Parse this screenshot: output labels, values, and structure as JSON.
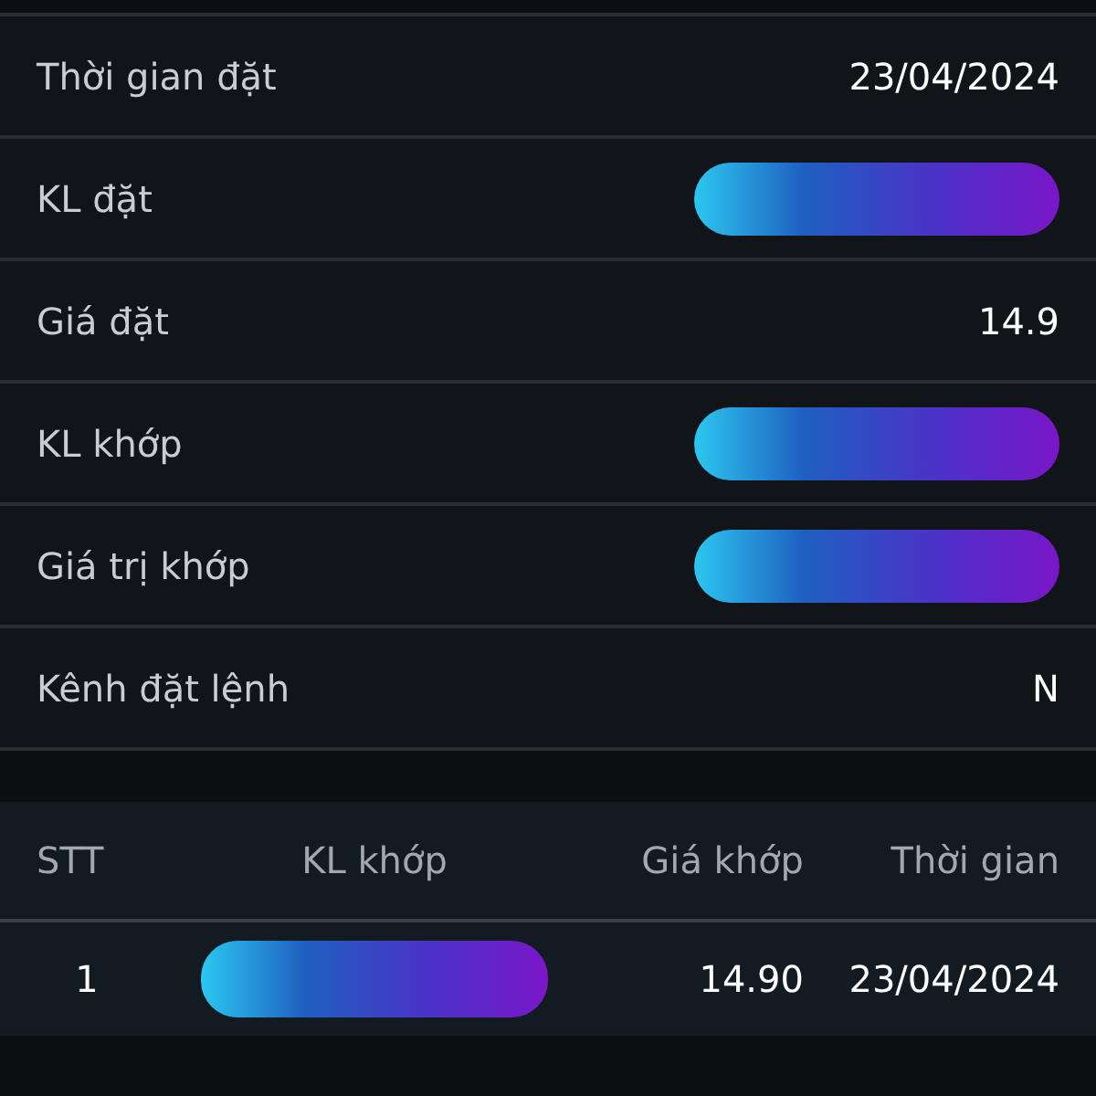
{
  "details": [
    {
      "label": "Thời gian đặt",
      "kind": "text",
      "value": "23/04/2024"
    },
    {
      "label": "KL đặt",
      "kind": "redacted"
    },
    {
      "label": "Giá đặt",
      "kind": "text",
      "value": "14.9"
    },
    {
      "label": "KL khớp",
      "kind": "redacted"
    },
    {
      "label": "Giá trị khớp",
      "kind": "redacted"
    },
    {
      "label": "Kênh đặt lệnh",
      "kind": "text",
      "value": "N"
    }
  ],
  "table": {
    "columns": [
      "STT",
      "KL khớp",
      "Giá khớp",
      "Thời gian"
    ],
    "rows": [
      [
        {
          "kind": "text",
          "value": "1"
        },
        {
          "kind": "redacted"
        },
        {
          "kind": "text",
          "value": "14.90"
        },
        {
          "kind": "text",
          "value": "23/04/2024"
        }
      ]
    ]
  }
}
